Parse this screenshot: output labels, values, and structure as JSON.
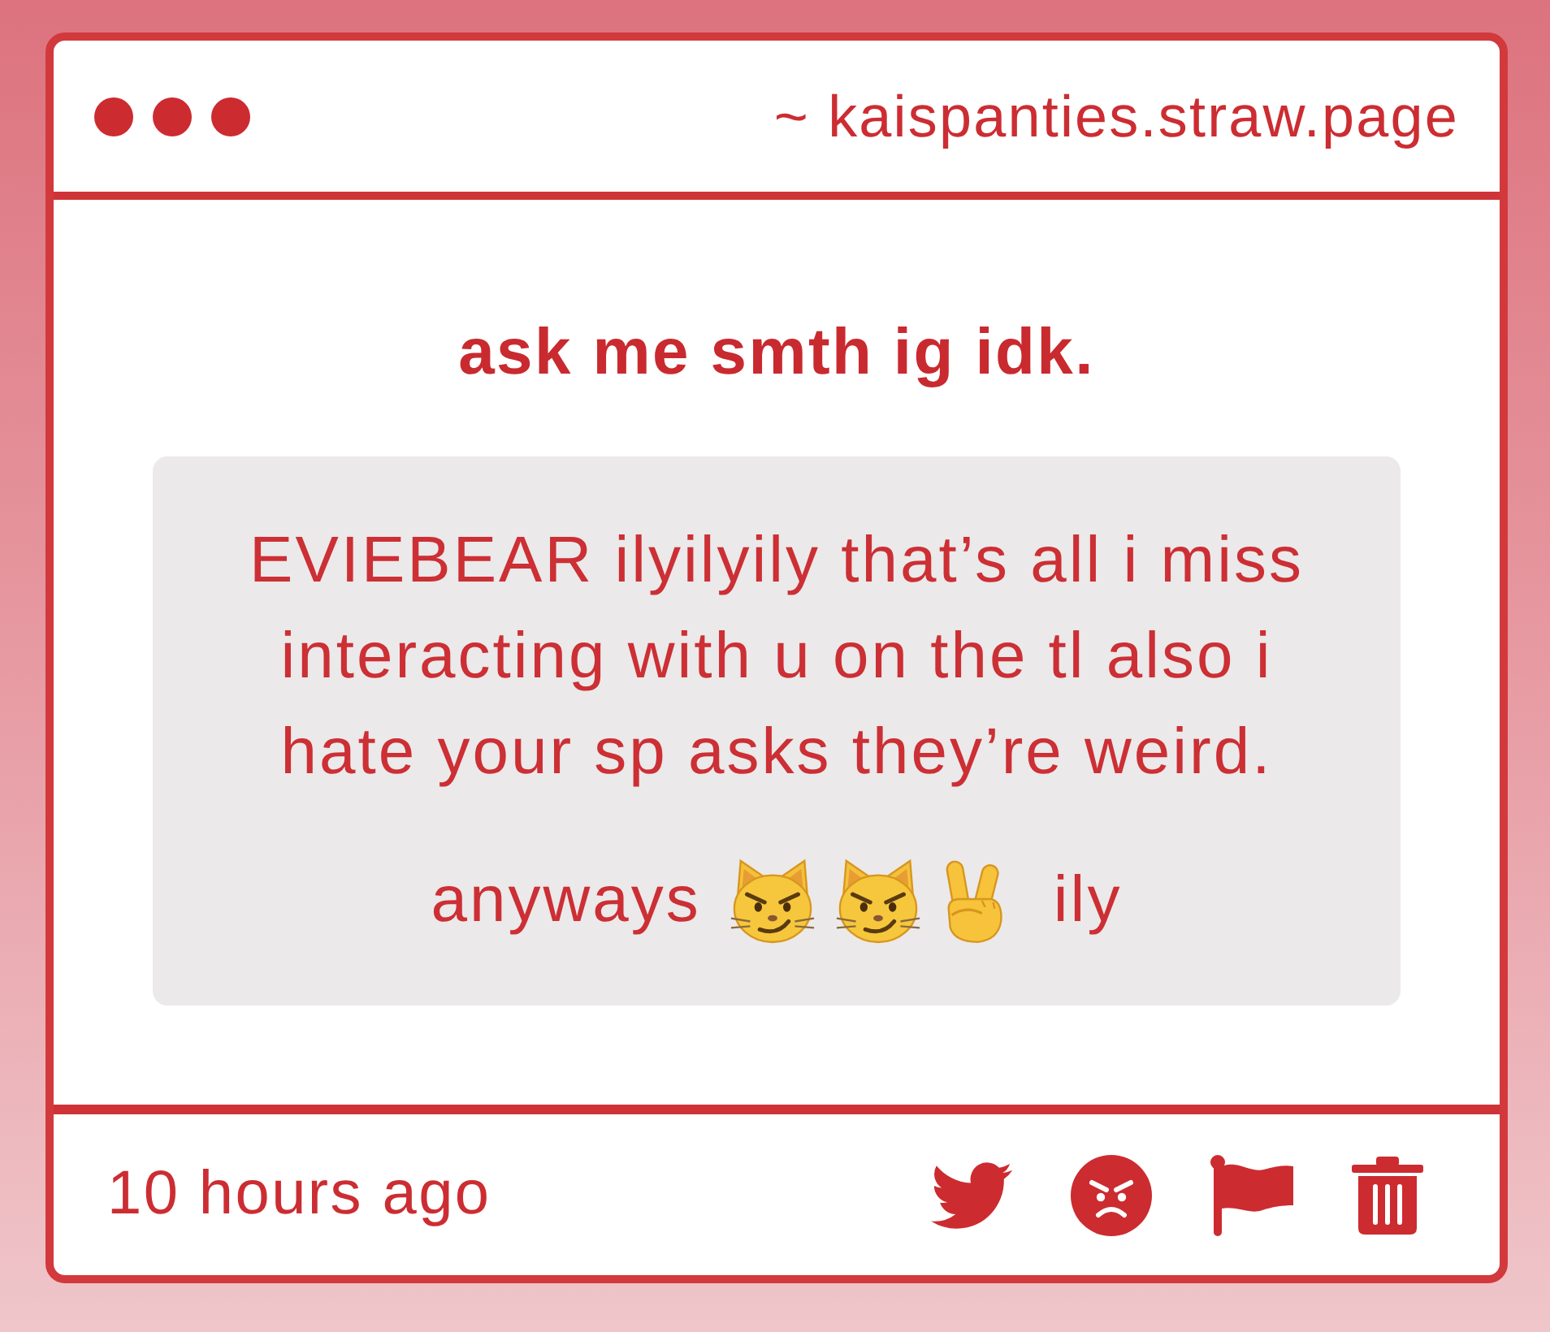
{
  "window": {
    "url": "~ kaispanties.straw.page"
  },
  "question": {
    "prompt": "ask me smth ig idk.",
    "message": "EVIEBEAR ilyilyily that’s all i miss interacting with u on the tl also i hate your sp asks they’re weird.",
    "closing_before": "anyways",
    "closing_after": "ily"
  },
  "footer": {
    "time": "10 hours ago"
  }
}
